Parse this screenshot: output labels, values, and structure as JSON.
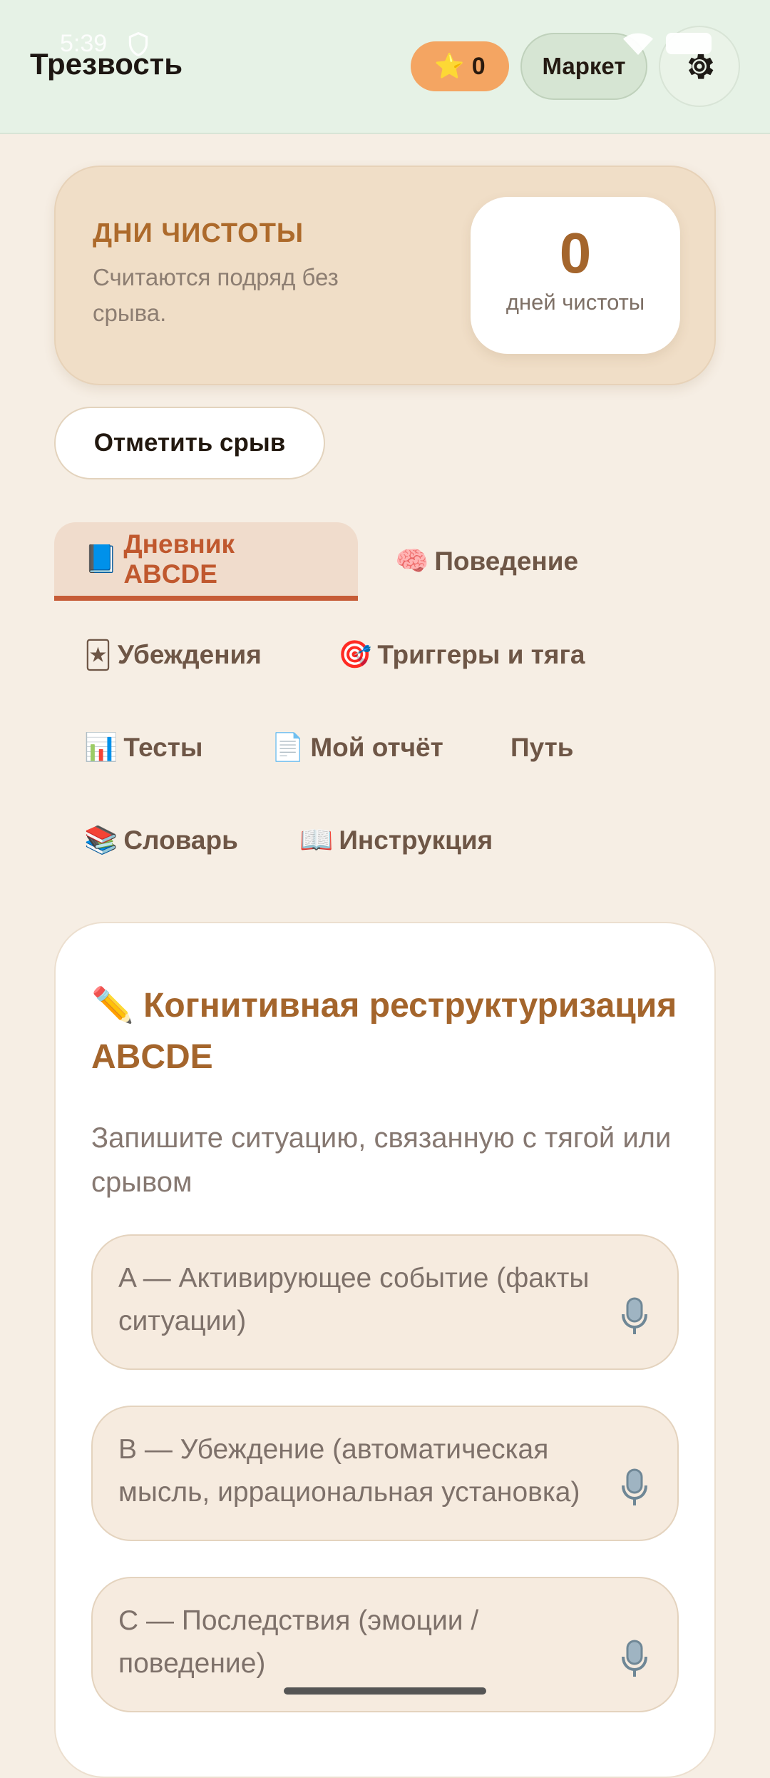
{
  "status": {
    "time": "5:39"
  },
  "header": {
    "title": "Трезвость",
    "stars": {
      "icon": "star-icon",
      "emoji": "⭐",
      "count": "0"
    },
    "market_label": "Маркет",
    "settings_icon": "gear-icon"
  },
  "days_card": {
    "title": "ДНИ ЧИСТОТЫ",
    "subtitle": "Считаются подряд без срыва.",
    "count": "0",
    "unit": "дней чистоты"
  },
  "relapse_button": "Отметить срыв",
  "tabs": [
    {
      "emoji": "📘",
      "label": "Дневник ABCDE",
      "active": true
    },
    {
      "emoji": "🧠",
      "label": "Поведение"
    },
    {
      "emoji": "🃏",
      "label": "Убеждения"
    },
    {
      "emoji": "🎯",
      "label": "Триггеры и тяга"
    },
    {
      "emoji": "📊",
      "label": "Тесты"
    },
    {
      "emoji": "📄",
      "label": "Мой отчёт"
    },
    {
      "emoji": "",
      "label": "Путь"
    },
    {
      "emoji": "📚",
      "label": "Словарь"
    },
    {
      "emoji": "📖",
      "label": "Инструкция"
    }
  ],
  "main": {
    "title": "✏️ Когнитивная реструктуризация ABCDE",
    "subtitle": "Запишите ситуацию, связанную с тягой или срывом",
    "fields": [
      {
        "placeholder": "A — Активирующее событие (факты ситуации)",
        "icon": "microphone-icon"
      },
      {
        "placeholder": "B — Убеждение (автоматическая мысль, иррациональная установка)",
        "icon": "microphone-icon"
      },
      {
        "placeholder": "C — Последствия (эмоции / поведение)",
        "icon": "microphone-icon"
      }
    ]
  },
  "colors": {
    "header_bg": "#e6f2e6",
    "page_bg": "#f6eee4",
    "accent": "#a4652c",
    "active_tab": "#c65c37",
    "stars_chip": "#f4a562"
  }
}
